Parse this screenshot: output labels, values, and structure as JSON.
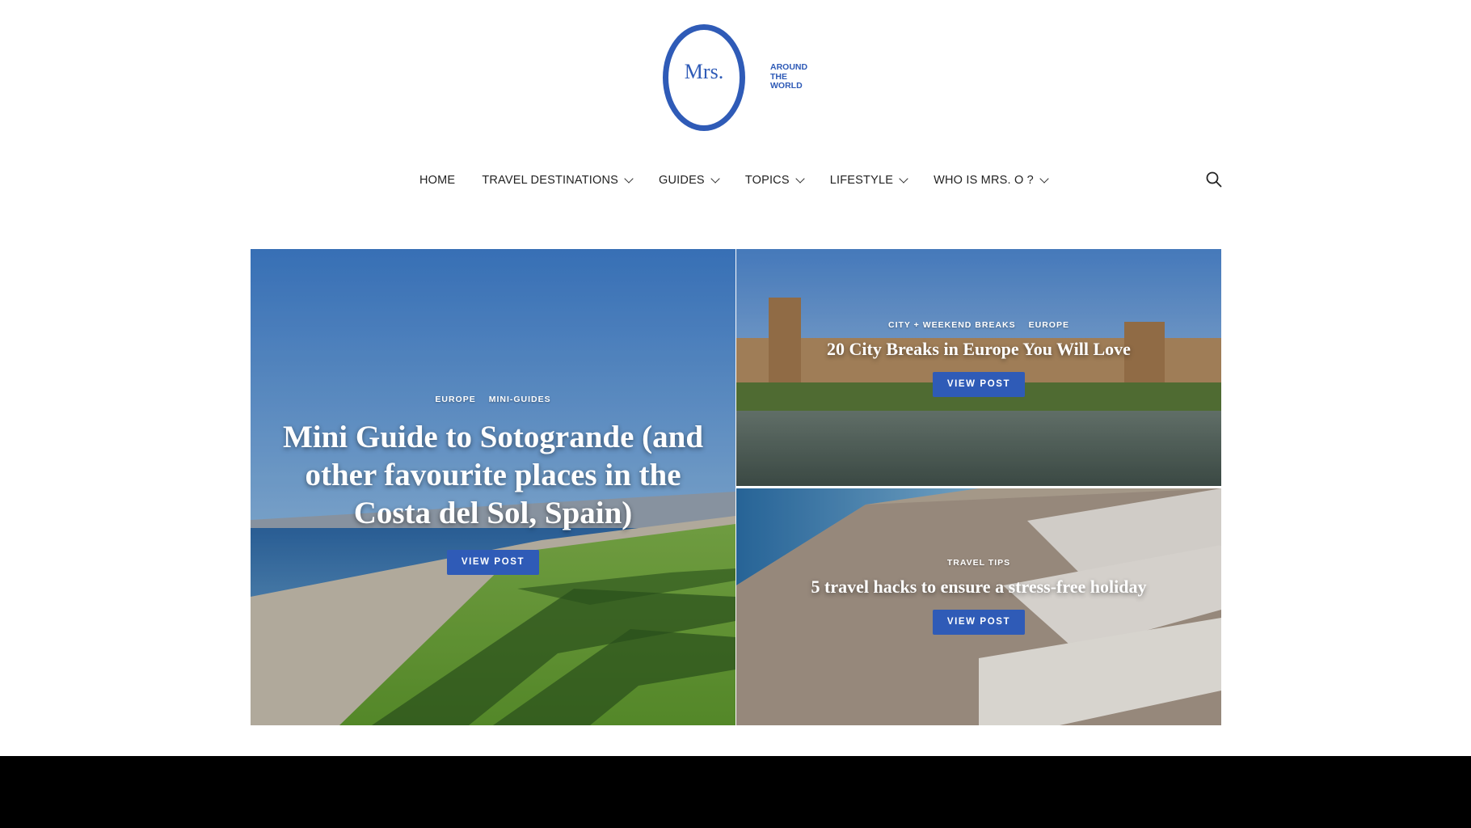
{
  "logo": {
    "mark_text": "Mrs.",
    "tagline": [
      "AROUND",
      "THE",
      "WORLD"
    ],
    "brand_color": "#2f5bb7"
  },
  "nav": {
    "items": [
      {
        "label": "HOME",
        "has_dropdown": false
      },
      {
        "label": "TRAVEL DESTINATIONS",
        "has_dropdown": true
      },
      {
        "label": "GUIDES",
        "has_dropdown": true
      },
      {
        "label": "TOPICS",
        "has_dropdown": true
      },
      {
        "label": "LIFESTYLE",
        "has_dropdown": true
      },
      {
        "label": "WHO IS MRS. O ?",
        "has_dropdown": true
      }
    ],
    "search_icon": "search-icon"
  },
  "posts": {
    "main": {
      "categories": [
        "EUROPE",
        "MINI-GUIDES"
      ],
      "title": "Mini Guide to Sotogrande (and other favourite places in the Costa del Sol, Spain)",
      "button": "VIEW POST"
    },
    "top_right": {
      "categories": [
        "CITY + WEEKEND BREAKS",
        "EUROPE"
      ],
      "title": "20 City Breaks in Europe You Will Love",
      "button": "VIEW POST"
    },
    "bottom_right": {
      "categories": [
        "TRAVEL TIPS"
      ],
      "title": "5 travel hacks to ensure a stress-free holiday",
      "button": "VIEW POST"
    }
  },
  "colors": {
    "accent": "#2f5bb7",
    "nav_text": "#222222",
    "bottom_bar": "#000000"
  }
}
